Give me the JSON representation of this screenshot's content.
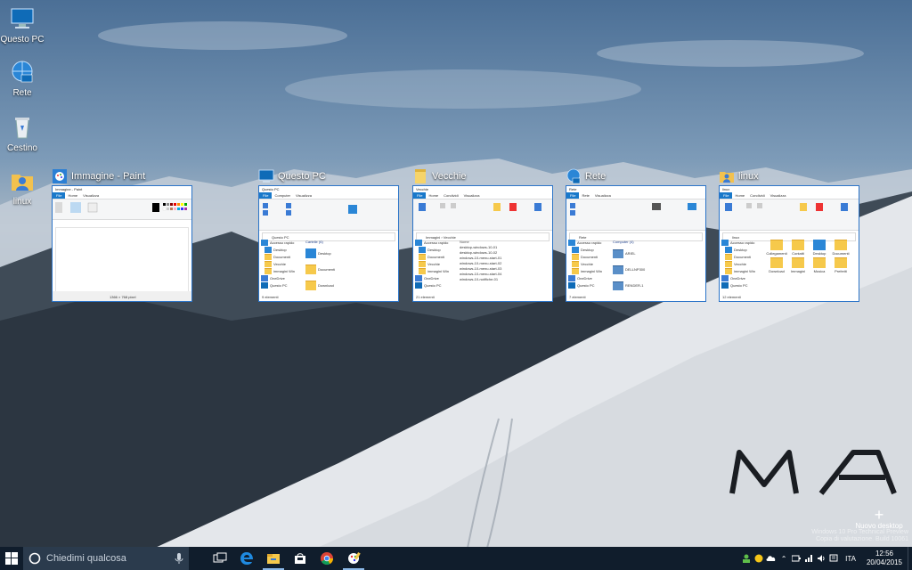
{
  "desktop_icons": [
    {
      "label": "Questo PC",
      "icon": "computer-icon"
    },
    {
      "label": "Rete",
      "icon": "network-icon"
    },
    {
      "label": "Cestino",
      "icon": "recycle-bin-icon"
    },
    {
      "label": "linux",
      "icon": "user-folder-icon"
    }
  ],
  "task_view": {
    "windows": [
      {
        "title": "Immagine - Paint",
        "icon": "paint-icon",
        "inner_title": "Immagine - Paint",
        "tabs": [
          "File",
          "Home",
          "Visualizza"
        ],
        "status": "1366 × 768 pixel"
      },
      {
        "title": "Questo PC",
        "icon": "this-pc-icon",
        "inner_title": "Questo PC",
        "tabs": [
          "File",
          "Computer",
          "Visualizza"
        ],
        "address": "Questo PC",
        "nav": [
          "Accesso rapido",
          "Desktop",
          "Documenti",
          "Vecchie",
          "immagini Win",
          "OneDrive",
          "Questo PC"
        ],
        "content_header": "Cartelle (6)",
        "items": [
          "Desktop",
          "Documenti",
          "Download"
        ],
        "status": "9 elementi"
      },
      {
        "title": "Vecchie",
        "icon": "folder-icon",
        "inner_title": "Vecchie",
        "tabs": [
          "File",
          "Home",
          "Condividi",
          "Visualizza"
        ],
        "address": "Immagini › Vecchie",
        "nav": [
          "Accesso rapido",
          "Desktop",
          "Documenti",
          "Vecchie",
          "immagini Win",
          "OneDrive",
          "Questo PC"
        ],
        "content_header": "Nome",
        "items": [
          "desktop-windows-10-01",
          "desktop-windows-10-02",
          "windows-10-menu-start-01",
          "windows-10-menu-start-02",
          "windows-10-menu-start-03",
          "windows-10-menu-start-04",
          "windows-10-notifiche-01"
        ],
        "status": "21 elementi"
      },
      {
        "title": "Rete",
        "icon": "network-window-icon",
        "inner_title": "Rete",
        "tabs": [
          "File",
          "Rete",
          "Visualizza"
        ],
        "address": "Rete",
        "nav": [
          "Accesso rapido",
          "Desktop",
          "Documenti",
          "Vecchie",
          "immagini Win",
          "OneDrive",
          "Questo PC"
        ],
        "content_header": "Computer (4)",
        "items": [
          "ARIEL",
          "DELLNP300",
          "RENDER-1"
        ],
        "status": "7 elementi"
      },
      {
        "title": "linux",
        "icon": "user-folder-window-icon",
        "inner_title": "linux",
        "tabs": [
          "File",
          "Home",
          "Condividi",
          "Visualizza"
        ],
        "address": "linux",
        "nav": [
          "Accesso rapido",
          "Desktop",
          "Documenti",
          "Vecchie",
          "immagini Win",
          "OneDrive",
          "Questo PC"
        ],
        "content_header": "",
        "items": [
          "Collegamenti",
          "Contatti",
          "Desktop",
          "Documenti",
          "Download",
          "Immagini",
          "Musica",
          "Preferiti"
        ],
        "status": "12 elementi"
      }
    ]
  },
  "new_desktop": {
    "label": "Nuovo desktop"
  },
  "logo_text": "MA",
  "watermark": [
    "Windows 10 Pro Technical Preview",
    "Copia di valutazione. Build 10061"
  ],
  "taskbar": {
    "search_placeholder": "Chiedimi qualcosa",
    "apps": [
      "task-view-icon",
      "edge-icon",
      "file-explorer-icon",
      "store-icon",
      "chrome-icon",
      "paint-icon"
    ],
    "tray_language": "ITA",
    "time": "12:56",
    "date": "20/04/2015"
  },
  "colors": {
    "accent": "#1979ca",
    "taskbar": "#101d2c",
    "folder": "#f6c94b"
  }
}
